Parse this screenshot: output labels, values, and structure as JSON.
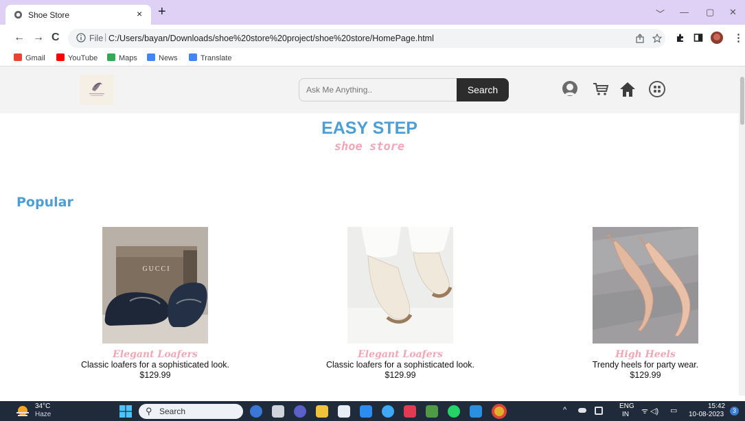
{
  "browser": {
    "tab_title": "Shoe Store",
    "tab_close": "×",
    "new_tab": "+",
    "window_controls": [
      "﹀",
      "—",
      "▢",
      "✕"
    ],
    "nav": {
      "back": "←",
      "forward": "→",
      "reload": "C"
    },
    "address": {
      "scheme": "File",
      "url": "C:/Users/bayan/Downloads/shoe%20store%20project/shoe%20store/HomePage.html"
    },
    "bookmarks": [
      {
        "label": "Gmail",
        "icon": "gmail-icon",
        "color": "#ea4335"
      },
      {
        "label": "YouTube",
        "icon": "youtube-icon",
        "color": "#ff0000"
      },
      {
        "label": "Maps",
        "icon": "maps-icon",
        "color": "#34a853"
      },
      {
        "label": "News",
        "icon": "news-icon",
        "color": "#4285f4"
      },
      {
        "label": "Translate",
        "icon": "translate-icon",
        "color": "#4285f4"
      }
    ]
  },
  "header": {
    "search_placeholder": "Ask Me Anything..",
    "search_button": "Search",
    "icons": [
      "account-icon",
      "cart-icon",
      "home-icon",
      "menu-grid-icon"
    ]
  },
  "brand": {
    "title": "EASY STEP",
    "subtitle": "shoe store"
  },
  "popular": {
    "title": "Popular",
    "products": [
      {
        "name": "Elegant Loafers",
        "description": "Classic loafers for a sophisticated look.",
        "price": "$129.99",
        "image": "navy-loafers-image"
      },
      {
        "name": "Elegant Loafers",
        "description": "Classic loafers for a sophisticated look.",
        "price": "$129.99",
        "image": "cream-loafers-image"
      },
      {
        "name": "High Heels",
        "description": "Trendy heels for party wear.",
        "price": "$129.99",
        "image": "nude-heels-image"
      }
    ]
  },
  "taskbar": {
    "weather_temp": "34°C",
    "weather_desc": "Haze",
    "search_label": "Search",
    "lang_top": "ENG",
    "lang_bottom": "IN",
    "time": "15:42",
    "date": "10-08-2023",
    "notification_count": "3"
  },
  "colors": {
    "accent_blue": "#4b9fd4",
    "accent_pink": "#f2a6b8",
    "tab_strip": "#dfd1f5",
    "header_bg": "#f3f3f3"
  }
}
